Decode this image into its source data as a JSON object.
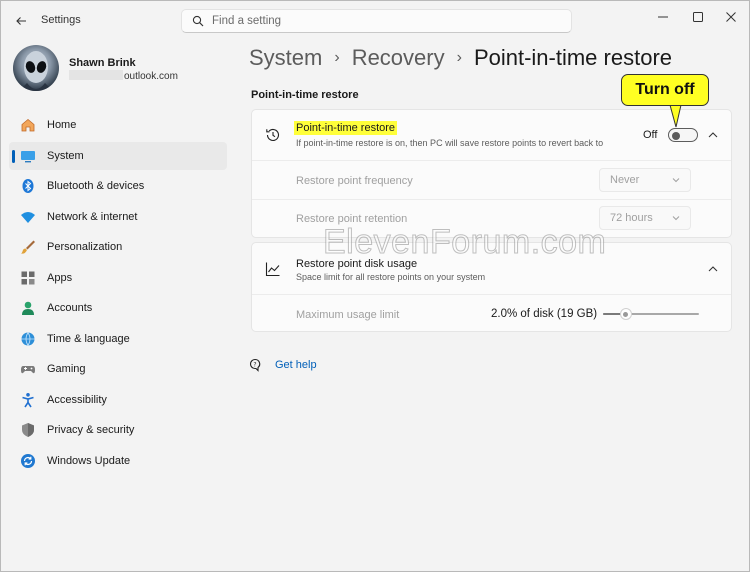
{
  "window": {
    "title": "Settings",
    "search_placeholder": "Find a setting"
  },
  "profile": {
    "name": "Shawn Brink",
    "email_visible": "outlook.com"
  },
  "nav": {
    "items": [
      {
        "label": "Home",
        "icon": "home-icon"
      },
      {
        "label": "System",
        "icon": "system-icon",
        "active": true
      },
      {
        "label": "Bluetooth & devices",
        "icon": "bluetooth-icon"
      },
      {
        "label": "Network & internet",
        "icon": "wifi-icon"
      },
      {
        "label": "Personalization",
        "icon": "brush-icon"
      },
      {
        "label": "Apps",
        "icon": "apps-icon"
      },
      {
        "label": "Accounts",
        "icon": "accounts-icon"
      },
      {
        "label": "Time & language",
        "icon": "globe-icon"
      },
      {
        "label": "Gaming",
        "icon": "gamepad-icon"
      },
      {
        "label": "Accessibility",
        "icon": "accessibility-icon"
      },
      {
        "label": "Privacy & security",
        "icon": "shield-icon"
      },
      {
        "label": "Windows Update",
        "icon": "update-icon"
      }
    ]
  },
  "breadcrumb": {
    "items": [
      "System",
      "Recovery",
      "Point-in-time restore"
    ],
    "separator": "›"
  },
  "section_title": "Point-in-time restore",
  "pitr_card": {
    "title": "Point-in-time restore",
    "description": "If point-in-time restore is on, then PC will save restore points to revert back to",
    "toggle_state": "Off",
    "toggle_on": false,
    "frequency_label": "Restore point frequency",
    "frequency_value": "Never",
    "retention_label": "Restore point retention",
    "retention_value": "72 hours"
  },
  "disk_card": {
    "title": "Restore point disk usage",
    "description": "Space limit for all restore points on your system",
    "max_label": "Maximum usage limit",
    "max_value": "2.0% of disk (19 GB)",
    "slider_fraction": 0.2
  },
  "callout": "Turn off",
  "watermark": "ElevenForum.com",
  "help_link": "Get help",
  "colors": {
    "accent": "#005fb8",
    "highlight": "#ffff3a",
    "callout_bg": "#ffff22"
  }
}
